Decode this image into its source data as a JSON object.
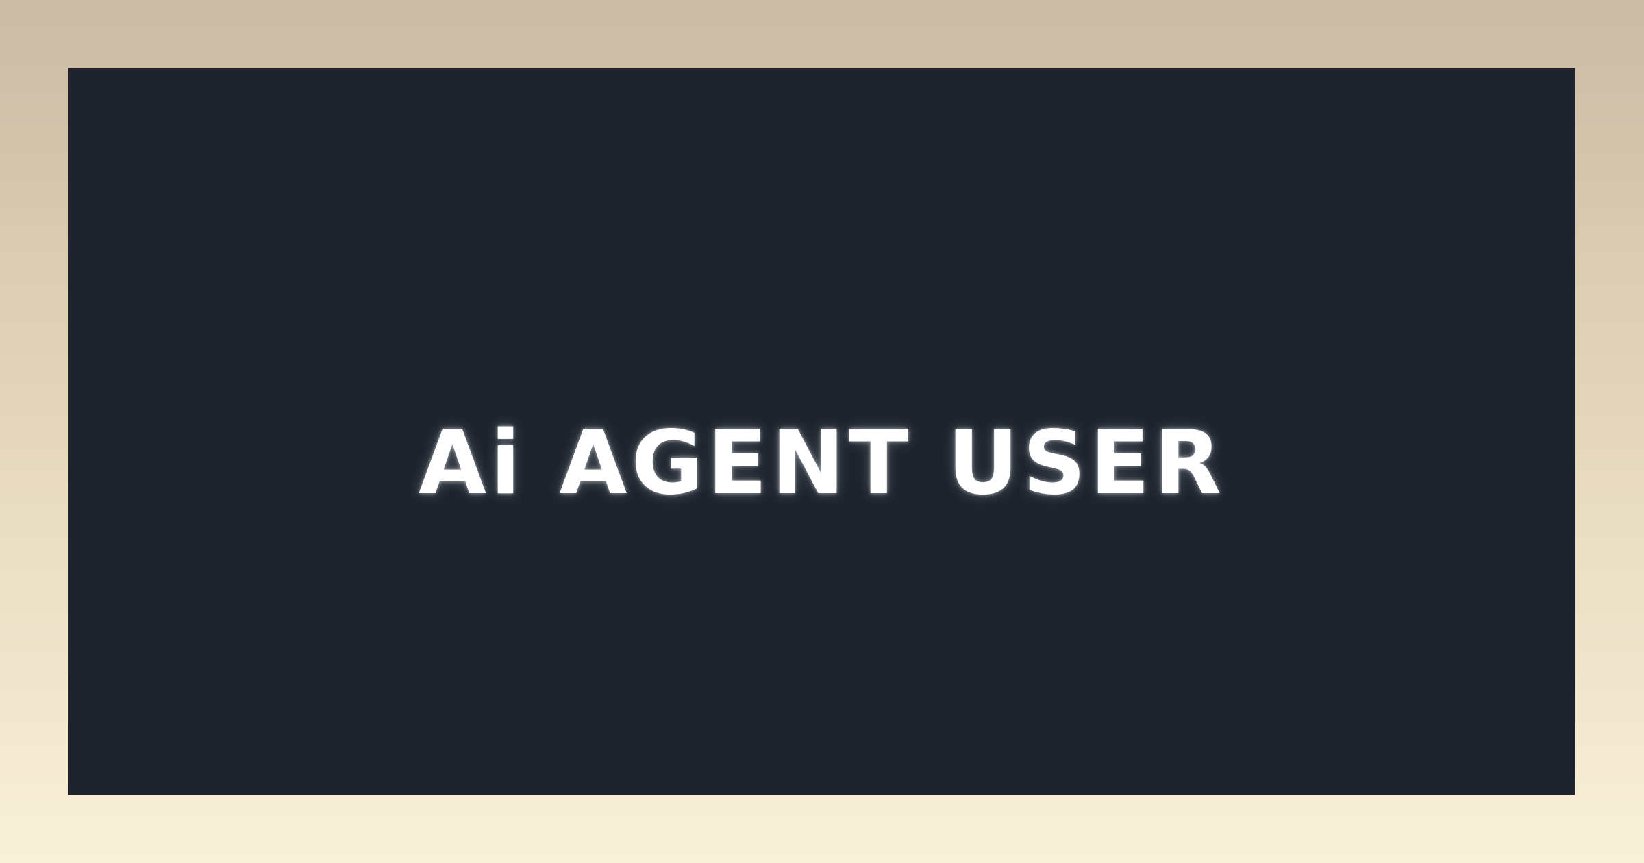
{
  "banner": {
    "title": "Ai AGENT USER"
  },
  "colors": {
    "background_top": "#cbbaa4",
    "background_bottom": "#f9f0d9",
    "panel": "#1e242d",
    "title_text": "#ffffff"
  }
}
